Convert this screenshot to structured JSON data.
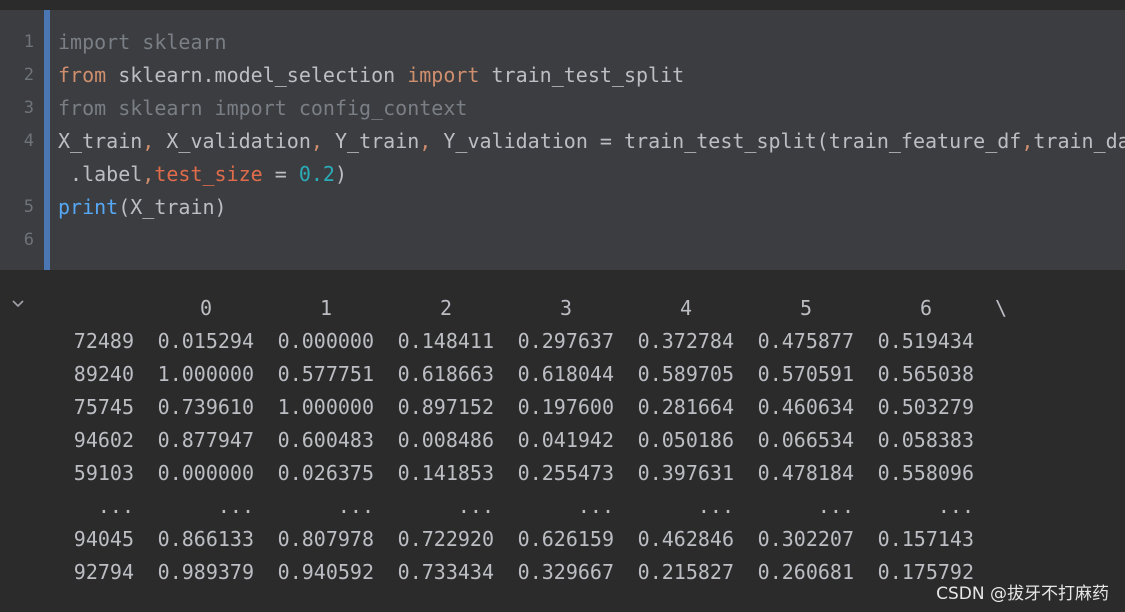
{
  "editor": {
    "line_numbers": [
      "1",
      "2",
      "3",
      "4",
      "5",
      "6"
    ],
    "lines": [
      [
        {
          "t": "import sklearn",
          "c": "dim"
        }
      ],
      [
        {
          "t": "from",
          "c": "kw"
        },
        {
          "t": " sklearn.model_selection ",
          "c": ""
        },
        {
          "t": "import",
          "c": "kw"
        },
        {
          "t": " train_test_split",
          "c": ""
        }
      ],
      [
        {
          "t": "from sklearn import config_context",
          "c": "dim"
        }
      ],
      [
        {
          "t": "X_train",
          "c": ""
        },
        {
          "t": ", ",
          "c": "kw"
        },
        {
          "t": "X_validation",
          "c": ""
        },
        {
          "t": ", ",
          "c": "kw"
        },
        {
          "t": "Y_train",
          "c": ""
        },
        {
          "t": ", ",
          "c": "kw"
        },
        {
          "t": "Y_validation = train_test_split(train_feature_df",
          "c": ""
        },
        {
          "t": ",",
          "c": "kw"
        },
        {
          "t": "train_data",
          "c": ""
        }
      ],
      [
        {
          "t": " .label",
          "c": ""
        },
        {
          "t": ",",
          "c": "kw"
        },
        {
          "t": "test_size",
          "c": "param"
        },
        {
          "t": " = ",
          "c": ""
        },
        {
          "t": "0.2",
          "c": "num"
        },
        {
          "t": ")",
          "c": ""
        }
      ],
      [
        {
          "t": "print",
          "c": "fn"
        },
        {
          "t": "(X_train)",
          "c": ""
        }
      ],
      [
        {
          "t": "",
          "c": ""
        }
      ]
    ]
  },
  "output": {
    "columns": [
      "0",
      "1",
      "2",
      "3",
      "4",
      "5",
      "6"
    ],
    "continuation": "\\",
    "rows": [
      {
        "index": "72489",
        "values": [
          "0.015294",
          "0.000000",
          "0.148411",
          "0.297637",
          "0.372784",
          "0.475877",
          "0.519434"
        ]
      },
      {
        "index": "89240",
        "values": [
          "1.000000",
          "0.577751",
          "0.618663",
          "0.618044",
          "0.589705",
          "0.570591",
          "0.565038"
        ]
      },
      {
        "index": "75745",
        "values": [
          "0.739610",
          "1.000000",
          "0.897152",
          "0.197600",
          "0.281664",
          "0.460634",
          "0.503279"
        ]
      },
      {
        "index": "94602",
        "values": [
          "0.877947",
          "0.600483",
          "0.008486",
          "0.041942",
          "0.050186",
          "0.066534",
          "0.058383"
        ]
      },
      {
        "index": "59103",
        "values": [
          "0.000000",
          "0.026375",
          "0.141853",
          "0.255473",
          "0.397631",
          "0.478184",
          "0.558096"
        ]
      },
      {
        "index": "...",
        "values": [
          "...",
          "...",
          "...",
          "...",
          "...",
          "...",
          "..."
        ]
      },
      {
        "index": "94045",
        "values": [
          "0.866133",
          "0.807978",
          "0.722920",
          "0.626159",
          "0.462846",
          "0.302207",
          "0.157143"
        ]
      },
      {
        "index": "92794",
        "values": [
          "0.989379",
          "0.940592",
          "0.733434",
          "0.329667",
          "0.215827",
          "0.260681",
          "0.175792"
        ]
      }
    ]
  },
  "watermark": "CSDN @拔牙不打麻药",
  "colors": {
    "cell_bg": "#3b3d40",
    "cell_bar": "#4a77b3",
    "keyword": "#cf8e6d",
    "number": "#2aacb8"
  },
  "icons": {
    "collapse": "chevron-down-icon"
  }
}
